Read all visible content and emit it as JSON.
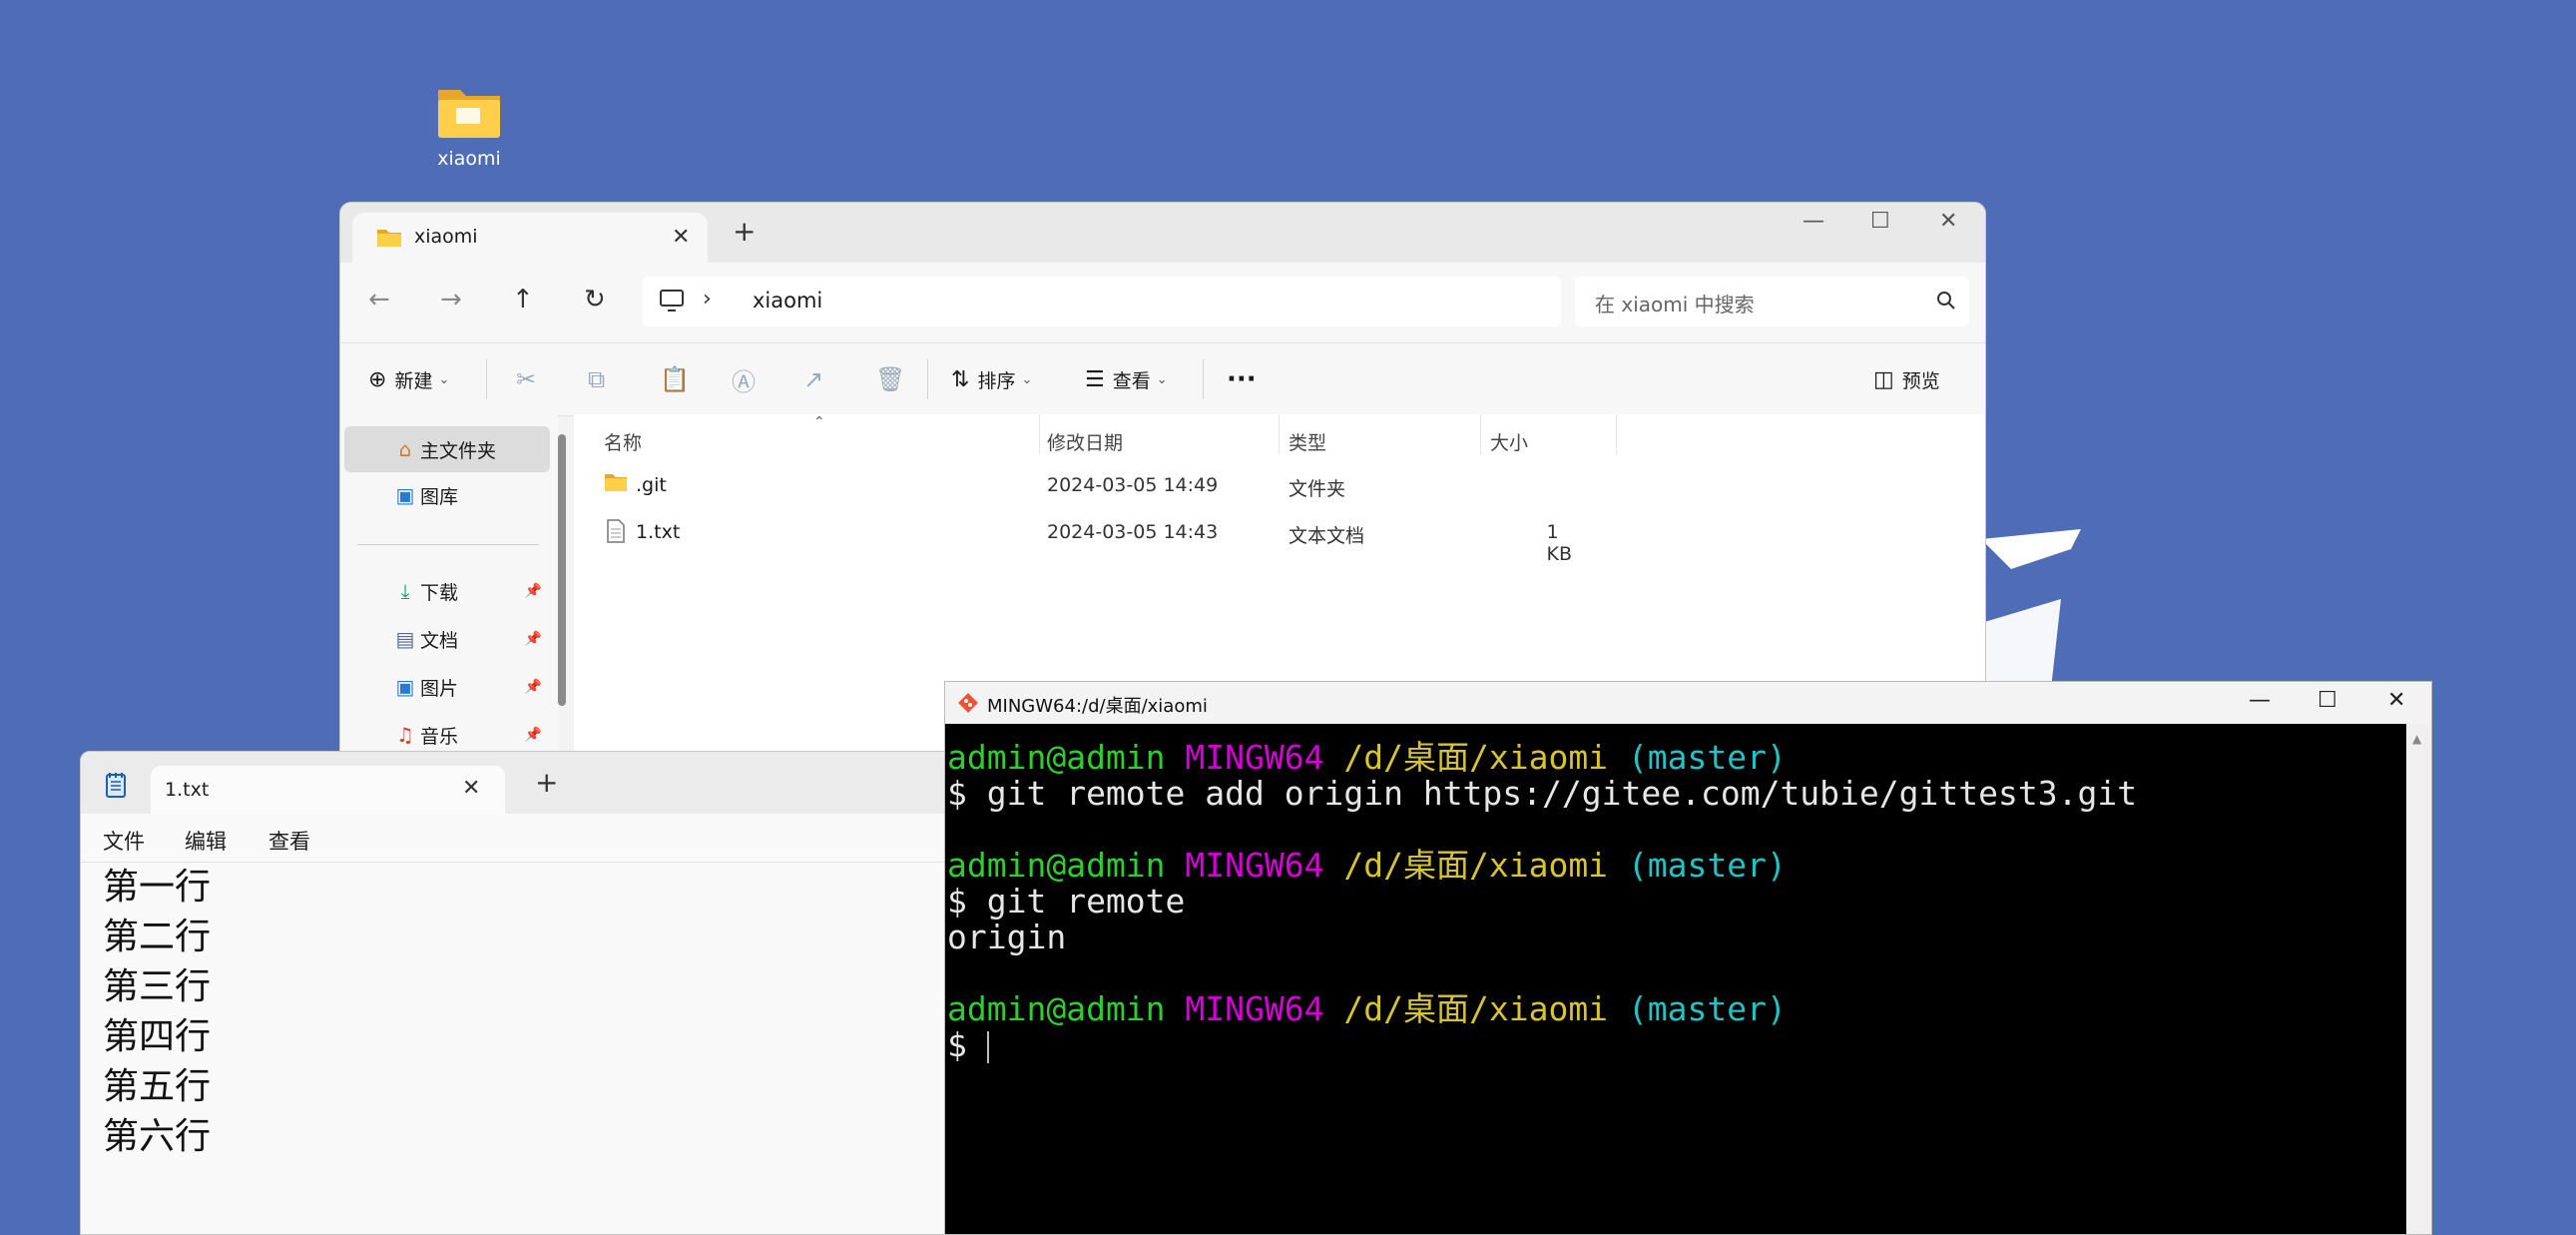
{
  "desktop": {
    "folder_label": "xiaomi"
  },
  "explorer": {
    "tab_title": "xiaomi",
    "path_segment": "xiaomi",
    "search_placeholder": "在 xiaomi 中搜索",
    "toolbar": {
      "new_label": "新建",
      "sort_label": "排序",
      "view_label": "查看",
      "more_label": "···",
      "preview_label": "预览"
    },
    "sidebar": {
      "items": [
        {
          "label": "主文件夹",
          "icon": "home-icon"
        },
        {
          "label": "图库",
          "icon": "gallery-icon"
        },
        {
          "label": "下载",
          "icon": "download-icon"
        },
        {
          "label": "文档",
          "icon": "document-icon"
        },
        {
          "label": "图片",
          "icon": "picture-icon"
        },
        {
          "label": "音乐",
          "icon": "music-icon"
        }
      ]
    },
    "columns": {
      "name": "名称",
      "modified": "修改日期",
      "type": "类型",
      "size": "大小"
    },
    "files": [
      {
        "name": ".git",
        "modified": "2024-03-05 14:49",
        "type": "文件夹",
        "size": ""
      },
      {
        "name": "1.txt",
        "modified": "2024-03-05 14:43",
        "type": "文本文档",
        "size": "1 KB"
      }
    ]
  },
  "notepad": {
    "tab_title": "1.txt",
    "menu": {
      "file": "文件",
      "edit": "编辑",
      "view": "查看"
    },
    "lines": [
      "第一行",
      "第二行",
      "第三行",
      "第四行",
      "第五行",
      "第六行"
    ]
  },
  "terminal": {
    "title": "MINGW64:/d/桌面/xiaomi",
    "prompt": {
      "user": "admin@admin",
      "env": "MINGW64",
      "path": "/d/桌面/xiaomi",
      "branch": "(master)"
    },
    "cmd1": "$ git remote add origin https://gitee.com/tubie/gittest3.git",
    "cmd2": "$ git remote",
    "out2": "origin",
    "cmd3": "$ "
  },
  "colors": {
    "desktop_bg": "#4f6cb6",
    "prompt_user": "#2fce2f",
    "prompt_env": "#d600d6",
    "prompt_path": "#d8c430",
    "prompt_branch": "#20c4c4"
  }
}
